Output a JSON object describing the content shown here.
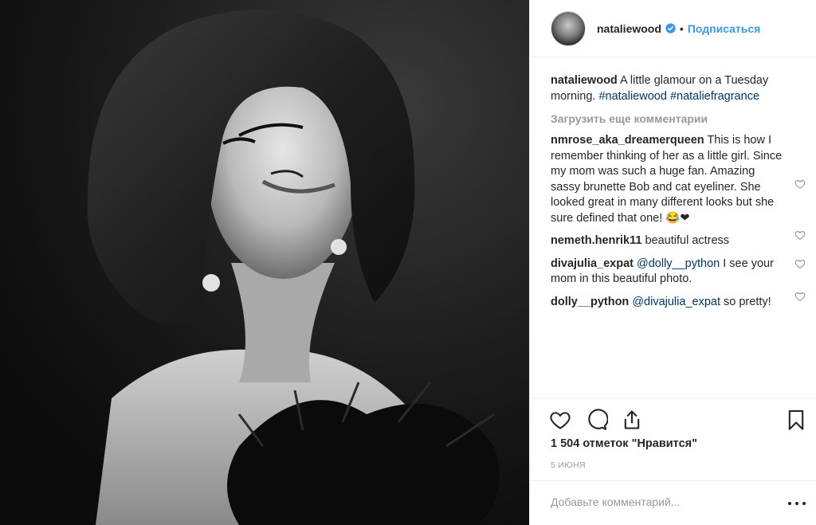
{
  "post": {
    "image_alt": "Black and white portrait photo",
    "header": {
      "username": "nataliewood",
      "separator": "•",
      "follow_label": "Подписаться"
    },
    "caption": {
      "username": "nataliewood",
      "text": "A little glamour on a Tuesday morning.",
      "hashtags": [
        "#nataliewood",
        "#nataliefragrance"
      ]
    },
    "load_more_label": "Загрузить еще комментарии",
    "comments": [
      {
        "username": "nmrose_aka_dreamerqueen",
        "text": "This is how I remember thinking of her as a little girl. Since my mom was such a huge fan. Amazing sassy brunette Bob and cat eyeliner. She looked great in many different looks but she sure defined that one! 😂❤"
      },
      {
        "username": "nemeth.henrik11",
        "text": "beautiful actress"
      },
      {
        "username": "divajulia_expat",
        "mention": "@dolly__python",
        "text": "I see your mom in this beautiful photo."
      },
      {
        "username": "dolly__python",
        "mention": "@divajulia_expat",
        "text": "so pretty!"
      }
    ],
    "likes_label": "1 504 отметок \"Нравится\"",
    "date": "5 ИЮНЯ",
    "add_comment_placeholder": "Добавьте комментарий...",
    "colors": {
      "link": "#003569",
      "follow": "#3897f0",
      "verified": "#3897f0",
      "muted": "#999999"
    }
  }
}
